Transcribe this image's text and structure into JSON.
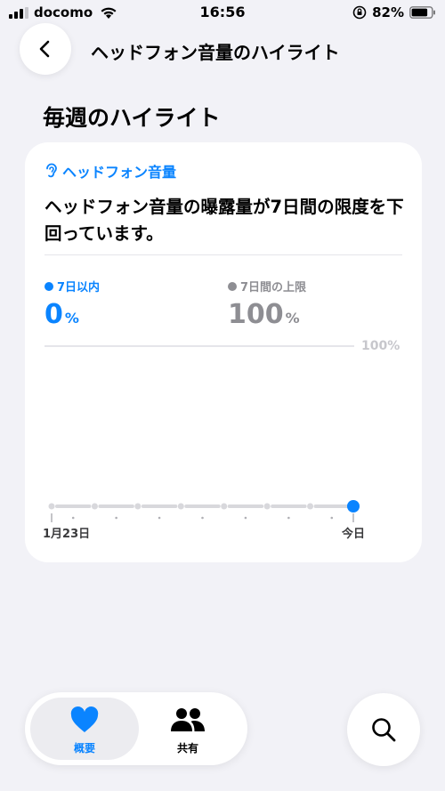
{
  "status_bar": {
    "carrier": "docomo",
    "time": "16:56",
    "battery": "82%"
  },
  "header": {
    "title": "ヘッドフォン音量のハイライト",
    "back_icon": "chevron-left-icon"
  },
  "section": {
    "title": "毎週のハイライト"
  },
  "card": {
    "category": "ヘッドフォン音量",
    "category_icon": "ear-icon",
    "headline": "ヘッドフォン音量の曝露量が7日間の限度を下回っています。",
    "stats": [
      {
        "label": "7日以内",
        "value": "0",
        "unit": "%",
        "color": "#0a84ff"
      },
      {
        "label": "7日間の上限",
        "value": "100",
        "unit": "%",
        "color": "#8e8e93"
      }
    ]
  },
  "chart_data": {
    "type": "line",
    "x": [
      "1月23日",
      "",
      "",
      "",
      "",
      "",
      "",
      "今日"
    ],
    "series": [
      {
        "values": [
          0,
          0,
          0,
          0,
          0,
          0,
          0,
          0
        ],
        "color": "#d8d8dc",
        "highlight_last": true,
        "highlight_color": "#0a84ff"
      }
    ],
    "limit": {
      "value": 100,
      "label": "100%"
    },
    "ylim": [
      0,
      100
    ],
    "tick_labels": [
      "1月23日",
      "今日"
    ]
  },
  "tab_bar": {
    "tabs": [
      {
        "label": "概要",
        "icon": "heart-icon",
        "selected": true
      },
      {
        "label": "共有",
        "icon": "people-icon",
        "selected": false
      }
    ],
    "search_icon": "search-icon"
  },
  "colors": {
    "accent": "#0a84ff",
    "background": "#f2f2f7"
  }
}
